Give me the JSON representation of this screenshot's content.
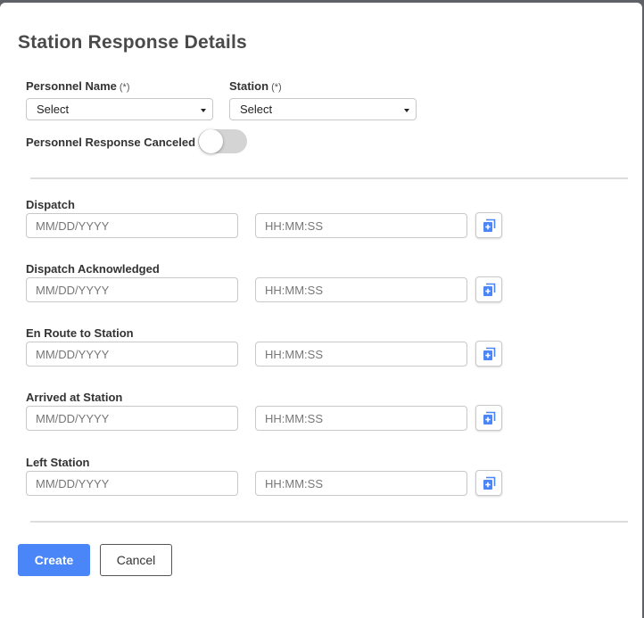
{
  "dialog": {
    "title": "Station Response Details"
  },
  "personnel": {
    "label": "Personnel Name",
    "required_mark": "(*)",
    "selected": "Select"
  },
  "station": {
    "label": "Station",
    "required_mark": "(*)",
    "selected": "Select"
  },
  "response_canceled": {
    "label": "Personnel Response Canceled",
    "on": false
  },
  "timestamps": [
    {
      "label": "Dispatch",
      "date_placeholder": "MM/DD/YYYY",
      "time_placeholder": "HH:MM:SS",
      "action_icon": "add-icon"
    },
    {
      "label": "Dispatch Acknowledged",
      "date_placeholder": "MM/DD/YYYY",
      "time_placeholder": "HH:MM:SS",
      "action_icon": "add-icon"
    },
    {
      "label": "En Route to Station",
      "date_placeholder": "MM/DD/YYYY",
      "time_placeholder": "HH:MM:SS",
      "action_icon": "add-icon"
    },
    {
      "label": "Arrived at Station",
      "date_placeholder": "MM/DD/YYYY",
      "time_placeholder": "HH:MM:SS",
      "action_icon": "add-icon"
    },
    {
      "label": "Left Station",
      "date_placeholder": "MM/DD/YYYY",
      "time_placeholder": "HH:MM:SS",
      "action_icon": "add-icon"
    }
  ],
  "actions": {
    "create_label": "Create",
    "cancel_label": "Cancel"
  },
  "colors": {
    "primary": "#4a86f7",
    "icon": "#4a86f7",
    "overlay": "#5f6166"
  }
}
